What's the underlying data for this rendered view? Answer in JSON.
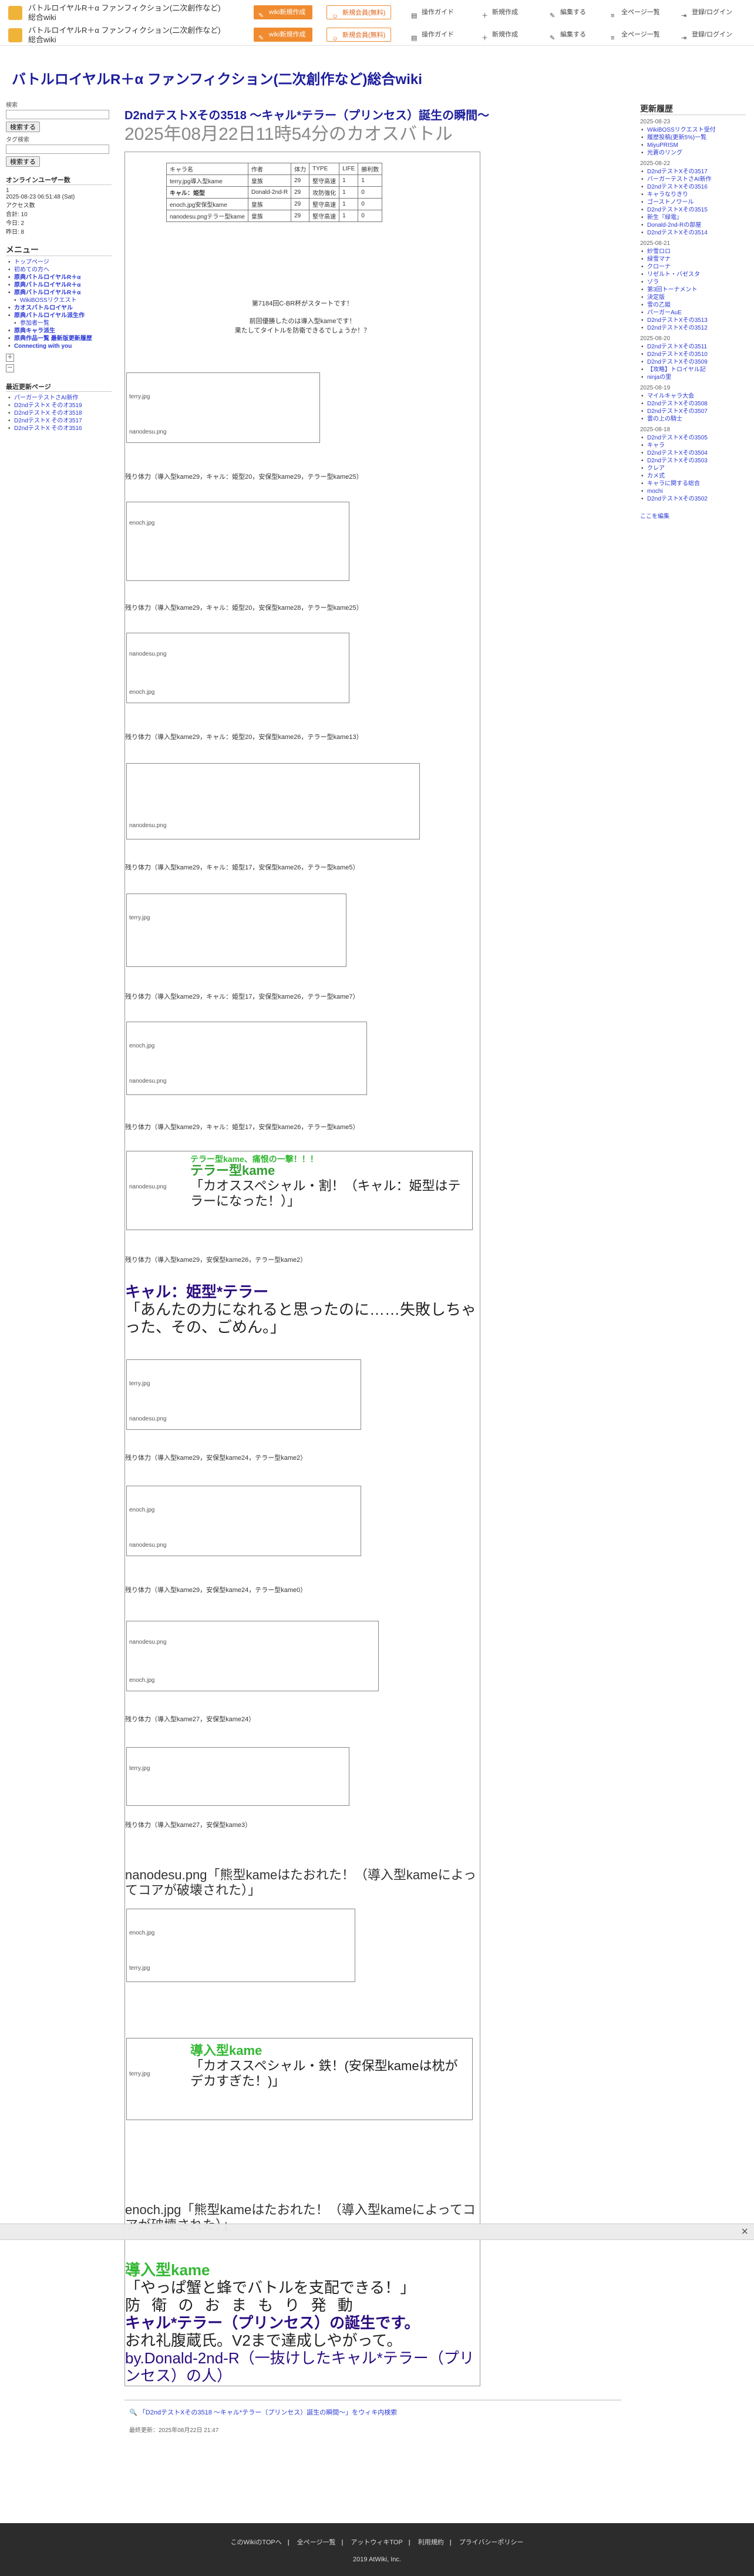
{
  "topbar": {
    "site_title": "バトルロイヤルR＋α ファンフィクション(二次創作など)総合wiki",
    "buttons": {
      "new_wiki": "wiki新規作成",
      "sign_up": "新規会員(無料)"
    },
    "menu": [
      "操作ガイド",
      "新規作成",
      "編集する",
      "全ページ一覧",
      "登録/ログイン"
    ]
  },
  "site_heading": "バトルロイヤルR＋α ファンフィクション(二次創作など)総合wiki",
  "left": {
    "search_label": "検索",
    "search_btn": "検索する",
    "tag_label": "タグ検索",
    "tag_btn": "検索する",
    "online_title": "オンラインユーザー数",
    "online_lines": [
      "1",
      "2025-08-23 06:51:48 (Sat)",
      "アクセス数",
      "合計: 10",
      "今日: 2",
      "昨日: 8"
    ],
    "menu_title": "メニュー",
    "menu": [
      {
        "t": "トップページ",
        "c": ""
      },
      {
        "t": "初めての方へ",
        "c": ""
      },
      {
        "t": "原典バトルロイヤルR＋α",
        "c": "b"
      },
      {
        "t": "原典バトルロイヤルR＋α",
        "c": "b"
      },
      {
        "t": "原典バトルロイヤルR＋α",
        "c": "b"
      },
      {
        "t": "WikiBOSSリクエスト",
        "c": "l2"
      },
      {
        "t": "カオスバトルロイヤル",
        "c": "b"
      },
      {
        "t": "原典バトルロイヤル派生作",
        "c": "b"
      },
      {
        "t": "参加者一覧",
        "c": "l2"
      },
      {
        "t": "原典キャラ派生",
        "c": "b"
      },
      {
        "t": "原典作品一覧 最新版更新履歴",
        "c": "b"
      },
      {
        "t": "Connecting with you",
        "c": "b"
      }
    ],
    "recent_title": "最近更新ページ",
    "recent": [
      "パーガーテストさAI新作",
      "D2ndテストX そのオ3519",
      "D2ndテストX そのオ3518",
      "D2ndテストX そのオ3517",
      "D2ndテストX そのオ3516"
    ]
  },
  "main": {
    "title": "D2ndテストXその3518 〜キャル*テラー（プリンセス）誕生の瞬間〜",
    "subtitle": "2025年08月22日11時54分のカオスバトル"
  },
  "stats": {
    "headers": [
      "キャラ名",
      "作者",
      "体力",
      "TYPE",
      "LIFE",
      "勝利数"
    ],
    "rows": [
      [
        "terry.jpg導入型kame",
        "皇族",
        "29",
        "堅守高速",
        "1",
        "1"
      ],
      [
        "キャル：姫型",
        "Donald-2nd-R",
        "29",
        "攻防強化",
        "1",
        "0"
      ],
      [
        "enoch.jpg安保型kame",
        "皇族",
        "29",
        "堅守高速",
        "1",
        "0"
      ],
      [
        "nanodesu.pngテラー型kame",
        "皇族",
        "29",
        "堅守高速",
        "1",
        "0"
      ]
    ]
  },
  "intro": [
    "第7184回C-BR杯がスタートです！",
    "前回優勝したのは導入型kameです！",
    "果たしてタイトルを防衛できるでしょうか！？"
  ],
  "hp_lines": [
    "残り体力（導入型kame29，キャル：姫型20，安保型kame29，テラー型kame25）",
    "残り体力（導入型kame29，キャル：姫型20，安保型kame28，テラー型kame25）",
    "残り体力（導入型kame29，キャル：姫型20，安保型kame26，テラー型kame13）",
    "残り体力（導入型kame29，キャル：姫型17，安保型kame26，テラー型kame5）",
    "残り体力（導入型kame29，キャル：姫型17，安保型kame26，テラー型kame7）",
    "残り体力（導入型kame29，キャル：姫型17，安保型kame26，テラー型kame5）",
    "残り体力（導入型kame29，安保型kame26，テラー型kame2）",
    "残り体力（導入型kame29，安保型kame24，テラー型kame2）",
    "残り体力（導入型kame29，安保型kame24，テラー型kame0）",
    "残り体力（導入型kame27，安保型kame24）",
    "残り体力（導入型kame27，安保型kame3）"
  ],
  "special1": {
    "a": "テラー型kame、痛恨の一撃！！！",
    "b": "テラー型kame",
    "c": "「カオススペシャル・割！（キャル：姫型はテラーになった！）」"
  },
  "special2": {
    "a": "キャル：姫型*テラー",
    "b": "「あんたの力になれると思ったのに……失敗しちゃった、その、ごめん。」"
  },
  "defeat1": {
    "img": "nanodesu.png",
    "t": "「熊型kameはたおれた！（導入型kameによってコアが破壊された）」"
  },
  "special3": {
    "a": "導入型kame",
    "b": "「カオススペシャル・鉄！(安保型kameは枕がデカすぎた！)」"
  },
  "defeat2": {
    "img": "enoch.jpg",
    "t": "「熊型kameはたおれた！（導入型kameによってコアが破壊された）」"
  },
  "ending": {
    "winner": "導入型kame",
    "quote": "「やっぱ蟹と蜂でバトルを支配できる！」",
    "l1": "防 衛 の お ま も り 発 動",
    "l2": "キャル*テラー（プリンセス）の誕生です。",
    "l3": "おれ礼腹蔵氏。V2まで達成しやがって。",
    "l4": "by.Donald-2nd-R（一抜けしたキャル*テラー（プリンセス）の人）"
  },
  "footer": {
    "link": "「D2ndテストXその3518 〜キャル*テラー（プリンセス）誕生の瞬間〜」をウィキ内検索",
    "updated": "最終更新：2025年08月22日 21:47"
  },
  "right": {
    "title": "更新履歴",
    "groups": [
      {
        "date": "2025-08-23",
        "items": [
          "WikiBOSSリクエスト受付",
          "履歴投稿(更新5%)一覧",
          "MiyuPRISM",
          "光蒼のリング"
        ]
      },
      {
        "date": "2025-08-22",
        "items": [
          "D2ndテストXその3517",
          "バーガーテストさAI新作",
          "D2ndテストXその3516",
          "キャラなりきり",
          "ゴーストノワール",
          "D2ndテストXその3515",
          "新生『緑電』",
          "Donald-2nd-Rの部屋",
          "D2ndテストXその3514"
        ]
      },
      {
        "date": "2025-08-21",
        "items": [
          "紗雪ロロ",
          "緑雪マナ",
          "クローナ",
          "リゼルト・バゼスタ",
          "ゾラ",
          "第3回トーナメント",
          "決定版",
          "雪の乙姫",
          "パーガーAuE",
          "D2ndテストXその3513",
          "D2ndテストXその3512"
        ]
      },
      {
        "date": "2025-08-20",
        "items": [
          "D2ndテストXその3511",
          "D2ndテストXその3510",
          "D2ndテストXその3509",
          "【攻略】トロイヤル記",
          "ninjaの里"
        ]
      },
      {
        "date": "2025-08-19",
        "items": [
          "マイルキャラ大会",
          "D2ndテストXその3508",
          "D2ndテストXその3507",
          "雲の上の騎士"
        ]
      },
      {
        "date": "2025-08-18",
        "items": [
          "D2ndテストXその3505",
          "キャラ",
          "D2ndテストXその3504",
          "D2ndテストXその3503",
          "クレア",
          "カメ式",
          "キャラに関する総合",
          "mochi",
          "D2ndテストXその3502"
        ]
      }
    ],
    "edit": "ここを編集"
  },
  "overlay": {
    "close": "×"
  },
  "bottom": {
    "links": [
      "このWikiのTOPへ",
      "全ページ一覧",
      "アットウィキTOP",
      "利用規約",
      "プライバシーポリシー"
    ],
    "copy": "2019 AtWiki, Inc."
  }
}
